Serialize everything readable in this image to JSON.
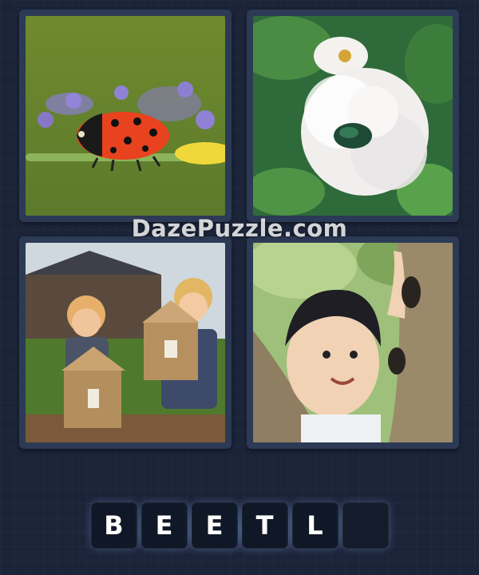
{
  "watermark": "DazePuzzle.com",
  "tiles": [
    {
      "subject": "ladybug on stem with purple flowers"
    },
    {
      "subject": "green beetle on white rose"
    },
    {
      "subject": "children holding insect hotels"
    },
    {
      "subject": "boy looking at beetles on tree"
    }
  ],
  "answer": {
    "letters": [
      "B",
      "E",
      "E",
      "T",
      "L",
      ""
    ]
  },
  "colors": {
    "background": "#1b2439",
    "tile_frame": "#2c3a55",
    "slot": "#101827",
    "letter": "#ffffff"
  }
}
